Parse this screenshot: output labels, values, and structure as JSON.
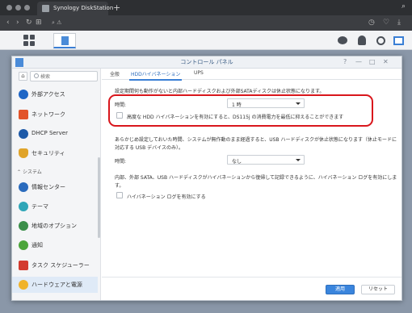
{
  "browser": {
    "tab_title": "Synology DiskStation",
    "new_tab": "+",
    "address_glyphs": "⚠"
  },
  "window": {
    "title": "コントロール パネル",
    "controls": [
      "?",
      "—",
      "□",
      "✕"
    ]
  },
  "sidebar": {
    "search_placeholder": "検索",
    "items": [
      {
        "label": "外部アクセス",
        "icon": "globe-icon",
        "color": "#1e66c6"
      },
      {
        "label": "ネットワーク",
        "icon": "house-network-icon",
        "color": "#e2542a"
      },
      {
        "label": "DHCP Server",
        "icon": "dhcp-icon",
        "color": "#1e5aa8"
      },
      {
        "label": "セキュリティ",
        "icon": "shield-icon",
        "color": "#e0a42a"
      },
      {
        "label": "情報センター",
        "icon": "info-icon",
        "color": "#2a6bbd"
      },
      {
        "label": "テーマ",
        "icon": "palette-icon",
        "color": "#2fa6b8"
      },
      {
        "label": "地域のオプション",
        "icon": "clock-globe-icon",
        "color": "#3b8f4a"
      },
      {
        "label": "通知",
        "icon": "chat-icon",
        "color": "#4ba53a"
      },
      {
        "label": "タスク スケジューラー",
        "icon": "calendar-icon",
        "color": "#d33b2f"
      },
      {
        "label": "ハードウェアと電源",
        "icon": "bulb-icon",
        "color": "#f0b32b"
      }
    ],
    "section_system": "システム"
  },
  "tabs": [
    {
      "label": "全般"
    },
    {
      "label": "HDDハイバネーション"
    },
    {
      "label": "UPS"
    }
  ],
  "content": {
    "intro": "設定期間何も動作がないと内部ハードディスクおよび外部SATAディスクは休止状態になります。",
    "time_label": "時間:",
    "time_value": "1 時",
    "advanced_checkbox": "高度な HDD ハイバネーションを有効にすると、DS115j の消費電力を最低に抑えることができます",
    "usb_intro_1": "あらかじめ設定しておいた時間、システムが無作動のまま経過すると、USB ハードディスクが休止状態になります（休止モードに",
    "usb_intro_2": "対応する USB デバイスのみ）。",
    "usb_time_label": "時間:",
    "usb_time_value": "なし",
    "log_intro": "内部、外部 SATA、USB ハードディスクがハイバネーションから復帰して記録できるように、ハイバネーション ログを有効にしま",
    "log_intro_2": "す。",
    "log_checkbox": "ハイバネーション ログを有効にする"
  },
  "footer": {
    "apply": "適用",
    "reset": "リセット"
  },
  "colors": {
    "accent": "#3a85dd",
    "highlight": "#d9161c"
  }
}
